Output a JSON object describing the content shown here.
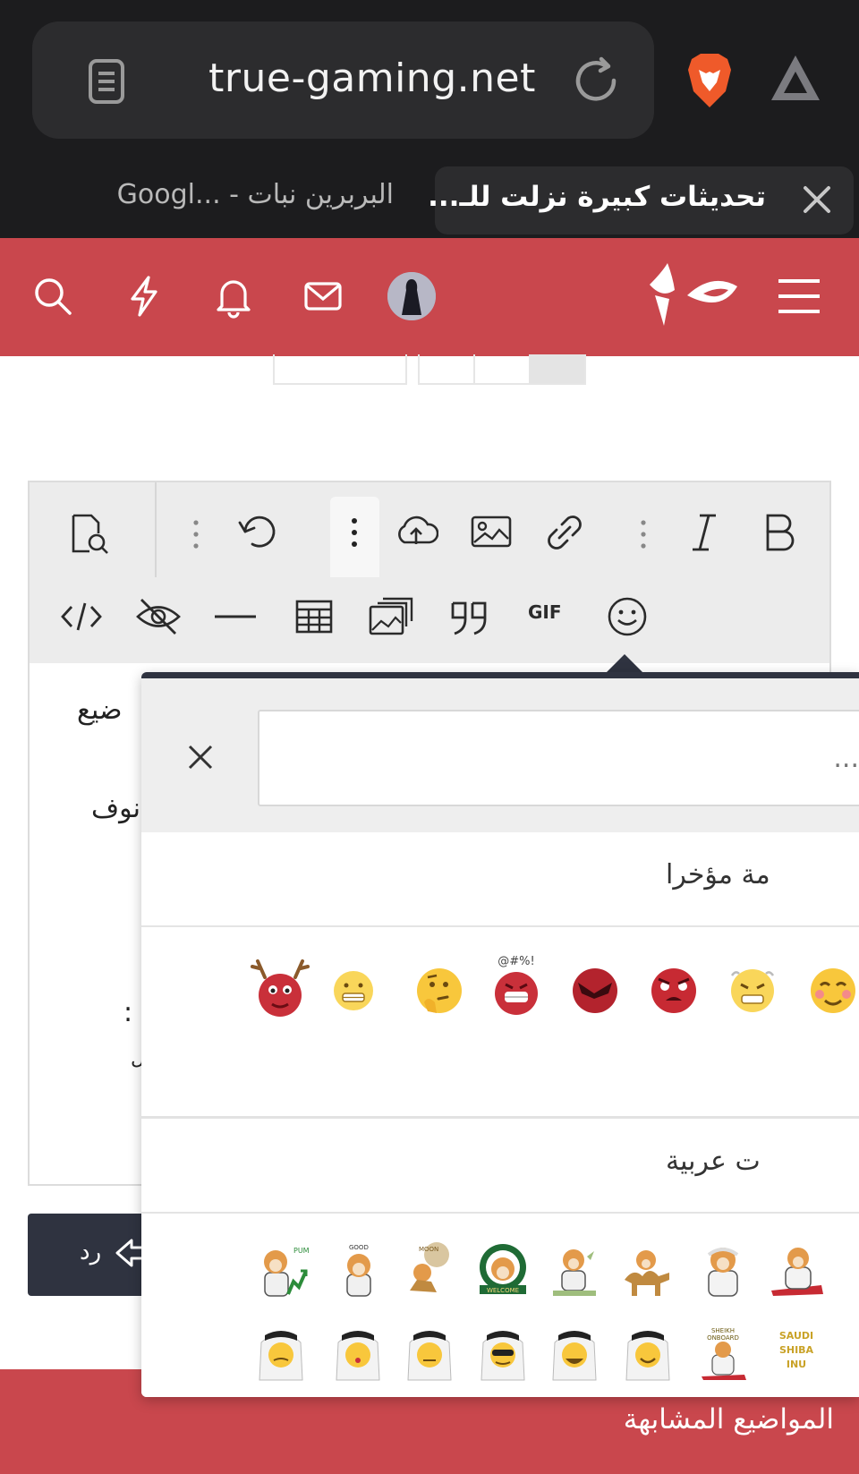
{
  "browser": {
    "url": "true-gaming.net",
    "tabs": [
      {
        "title": "البربرين نبات - ...Googl",
        "active": false
      },
      {
        "title": "تحديثات كبيرة نزلت للـ...",
        "active": true
      }
    ]
  },
  "header": {
    "icons": [
      "search-icon",
      "lightning-icon",
      "bell-icon",
      "mail-icon",
      "avatar",
      "logo",
      "menu-icon"
    ],
    "accent": "#c9474d"
  },
  "editor": {
    "toolbar_row1": [
      "preview-icon",
      "more-options-icon",
      "undo-icon",
      "more-insert-icon",
      "upload-icon",
      "image-icon",
      "link-icon",
      "more-format-icon",
      "italic-icon",
      "bold-icon"
    ],
    "toolbar_row2": [
      "code-icon",
      "spoiler-icon",
      "horizontal-rule-icon",
      "table-icon",
      "gallery-icon",
      "quote-icon",
      "gif-button",
      "smilies-button"
    ],
    "gif_label": "GIF",
    "body_fragments": [
      "ضيع",
      "نوف",
      ":",
      "ل"
    ]
  },
  "reply_button": {
    "label": "رد"
  },
  "similar_threads": {
    "label": "المواضيع المشابهة"
  },
  "emoji_popup": {
    "search_placeholder": "...",
    "recent_label": "مة مؤخرا",
    "arabic_label": "ت عربية",
    "recent_emojis": [
      "reindeer-emoji",
      "grimace-emoji",
      "thinking-emoji",
      "swearing-emoji",
      "angry-devil-emoji",
      "angry-red-emoji",
      "frustrated-emoji",
      "blushing-emoji"
    ],
    "arabic_stickers_row1": [
      "shiba-pump-sticker",
      "shiba-good-sticker",
      "shiba-moon-sticker",
      "shiba-welcome-sticker",
      "shiba-money-sticker",
      "shiba-camel-sticker",
      "shiba-saudi-sticker",
      "shiba-carpet-sticker"
    ],
    "arabic_stickers_row2": [
      "saudi-man-sticker",
      "saudi-kiss-sticker",
      "saudi-neutral-sticker",
      "saudi-cool-sticker",
      "saudi-laugh-sticker",
      "saudi-smile-sticker",
      "sheikh-onboard-sticker",
      "saudi-shiba-inu-sticker"
    ]
  }
}
